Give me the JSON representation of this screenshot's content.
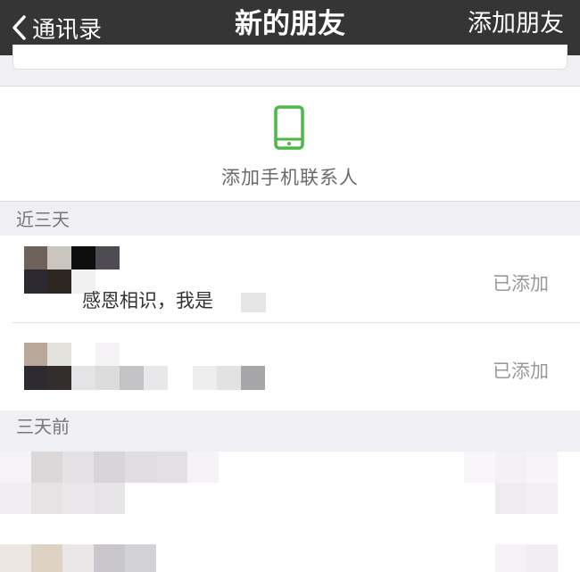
{
  "nav": {
    "back_label": "通讯录",
    "title": "新的朋友",
    "action_label": "添加朋友"
  },
  "add_phone": {
    "icon": "mobile-phone-icon",
    "label": "添加手机联系人",
    "icon_color": "#4cb847"
  },
  "sections": {
    "recent": "近三天",
    "older": "三天前"
  },
  "friends": [
    {
      "message": "感恩相识，我是",
      "status": "已添加"
    },
    {
      "message": "",
      "status": "已添加"
    }
  ],
  "colors": {
    "navbar": "#353535",
    "background": "#efeff4",
    "status_text": "#999999"
  }
}
